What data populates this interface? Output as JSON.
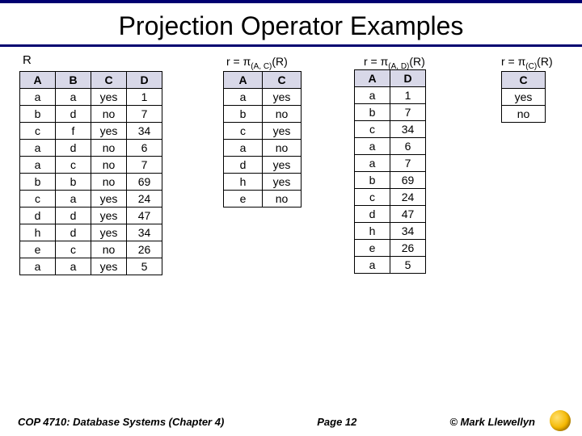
{
  "title": "Projection Operator Examples",
  "labels": {
    "R": "R",
    "AC": "r = π(A, C)(R)",
    "AD": "r = π(A, D)(R)",
    "C": "r = π(C)(R)"
  },
  "tables": {
    "R": {
      "headers": [
        "A",
        "B",
        "C",
        "D"
      ],
      "rows": [
        [
          "a",
          "a",
          "yes",
          "1"
        ],
        [
          "b",
          "d",
          "no",
          "7"
        ],
        [
          "c",
          "f",
          "yes",
          "34"
        ],
        [
          "a",
          "d",
          "no",
          "6"
        ],
        [
          "a",
          "c",
          "no",
          "7"
        ],
        [
          "b",
          "b",
          "no",
          "69"
        ],
        [
          "c",
          "a",
          "yes",
          "24"
        ],
        [
          "d",
          "d",
          "yes",
          "47"
        ],
        [
          "h",
          "d",
          "yes",
          "34"
        ],
        [
          "e",
          "c",
          "no",
          "26"
        ],
        [
          "a",
          "a",
          "yes",
          "5"
        ]
      ]
    },
    "AC": {
      "headers": [
        "A",
        "C"
      ],
      "rows": [
        [
          "a",
          "yes"
        ],
        [
          "b",
          "no"
        ],
        [
          "c",
          "yes"
        ],
        [
          "a",
          "no"
        ],
        [
          "d",
          "yes"
        ],
        [
          "h",
          "yes"
        ],
        [
          "e",
          "no"
        ]
      ]
    },
    "AD": {
      "headers": [
        "A",
        "D"
      ],
      "rows": [
        [
          "a",
          "1"
        ],
        [
          "b",
          "7"
        ],
        [
          "c",
          "34"
        ],
        [
          "a",
          "6"
        ],
        [
          "a",
          "7"
        ],
        [
          "b",
          "69"
        ],
        [
          "c",
          "24"
        ],
        [
          "d",
          "47"
        ],
        [
          "h",
          "34"
        ],
        [
          "e",
          "26"
        ],
        [
          "a",
          "5"
        ]
      ]
    },
    "C": {
      "headers": [
        "C"
      ],
      "rows": [
        [
          "yes"
        ],
        [
          "no"
        ]
      ]
    }
  },
  "footer": {
    "left": "COP 4710: Database Systems  (Chapter 4)",
    "mid": "Page 12",
    "right": "© Mark Llewellyn"
  }
}
